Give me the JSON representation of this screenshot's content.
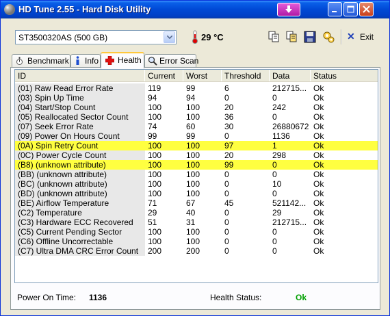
{
  "window": {
    "title": "HD Tune 2.55 - Hard Disk Utility"
  },
  "toolbar": {
    "drive": "ST3500320AS (500 GB)",
    "temperature": "29 °C",
    "exit_label": "Exit",
    "icons": [
      "copy-icon",
      "copy-all-icon",
      "save-icon",
      "options-icon"
    ]
  },
  "tabs": [
    {
      "label": "Benchmark"
    },
    {
      "label": "Info"
    },
    {
      "label": "Health"
    },
    {
      "label": "Error Scan"
    }
  ],
  "table": {
    "columns": [
      "ID",
      "Current",
      "Worst",
      "Threshold",
      "Data",
      "Status"
    ],
    "rows": [
      {
        "id": "(01) Raw Read Error Rate",
        "current": "119",
        "worst": "99",
        "threshold": "6",
        "data": "212715...",
        "status": "Ok",
        "highlight": false
      },
      {
        "id": "(03) Spin Up Time",
        "current": "94",
        "worst": "94",
        "threshold": "0",
        "data": "0",
        "status": "Ok",
        "highlight": false
      },
      {
        "id": "(04) Start/Stop Count",
        "current": "100",
        "worst": "100",
        "threshold": "20",
        "data": "242",
        "status": "Ok",
        "highlight": false
      },
      {
        "id": "(05) Reallocated Sector Count",
        "current": "100",
        "worst": "100",
        "threshold": "36",
        "data": "0",
        "status": "Ok",
        "highlight": false
      },
      {
        "id": "(07) Seek Error Rate",
        "current": "74",
        "worst": "60",
        "threshold": "30",
        "data": "26880672",
        "status": "Ok",
        "highlight": false
      },
      {
        "id": "(09) Power On Hours Count",
        "current": "99",
        "worst": "99",
        "threshold": "0",
        "data": "1136",
        "status": "Ok",
        "highlight": false
      },
      {
        "id": "(0A) Spin Retry Count",
        "current": "100",
        "worst": "100",
        "threshold": "97",
        "data": "1",
        "status": "Ok",
        "highlight": true
      },
      {
        "id": "(0C) Power Cycle Count",
        "current": "100",
        "worst": "100",
        "threshold": "20",
        "data": "298",
        "status": "Ok",
        "highlight": false
      },
      {
        "id": "(B8) (unknown attribute)",
        "current": "100",
        "worst": "100",
        "threshold": "99",
        "data": "0",
        "status": "Ok",
        "highlight": true
      },
      {
        "id": "(BB) (unknown attribute)",
        "current": "100",
        "worst": "100",
        "threshold": "0",
        "data": "0",
        "status": "Ok",
        "highlight": false
      },
      {
        "id": "(BC) (unknown attribute)",
        "current": "100",
        "worst": "100",
        "threshold": "0",
        "data": "10",
        "status": "Ok",
        "highlight": false
      },
      {
        "id": "(BD) (unknown attribute)",
        "current": "100",
        "worst": "100",
        "threshold": "0",
        "data": "0",
        "status": "Ok",
        "highlight": false
      },
      {
        "id": "(BE) Airflow Temperature",
        "current": "71",
        "worst": "67",
        "threshold": "45",
        "data": "521142...",
        "status": "Ok",
        "highlight": false
      },
      {
        "id": "(C2) Temperature",
        "current": "29",
        "worst": "40",
        "threshold": "0",
        "data": "29",
        "status": "Ok",
        "highlight": false
      },
      {
        "id": "(C3) Hardware ECC Recovered",
        "current": "51",
        "worst": "31",
        "threshold": "0",
        "data": "212715...",
        "status": "Ok",
        "highlight": false
      },
      {
        "id": "(C5) Current Pending Sector",
        "current": "100",
        "worst": "100",
        "threshold": "0",
        "data": "0",
        "status": "Ok",
        "highlight": false
      },
      {
        "id": "(C6) Offline Uncorrectable",
        "current": "100",
        "worst": "100",
        "threshold": "0",
        "data": "0",
        "status": "Ok",
        "highlight": false
      },
      {
        "id": "(C7) Ultra DMA CRC Error Count",
        "current": "200",
        "worst": "200",
        "threshold": "0",
        "data": "0",
        "status": "Ok",
        "highlight": false
      }
    ]
  },
  "footer": {
    "power_on_label": "Power On Time:",
    "power_on_value": "1136",
    "health_label": "Health Status:",
    "health_value": "Ok"
  },
  "colors": {
    "highlight": "#ffff40",
    "ok_green": "#00a000",
    "title_blue": "#0049d5"
  }
}
